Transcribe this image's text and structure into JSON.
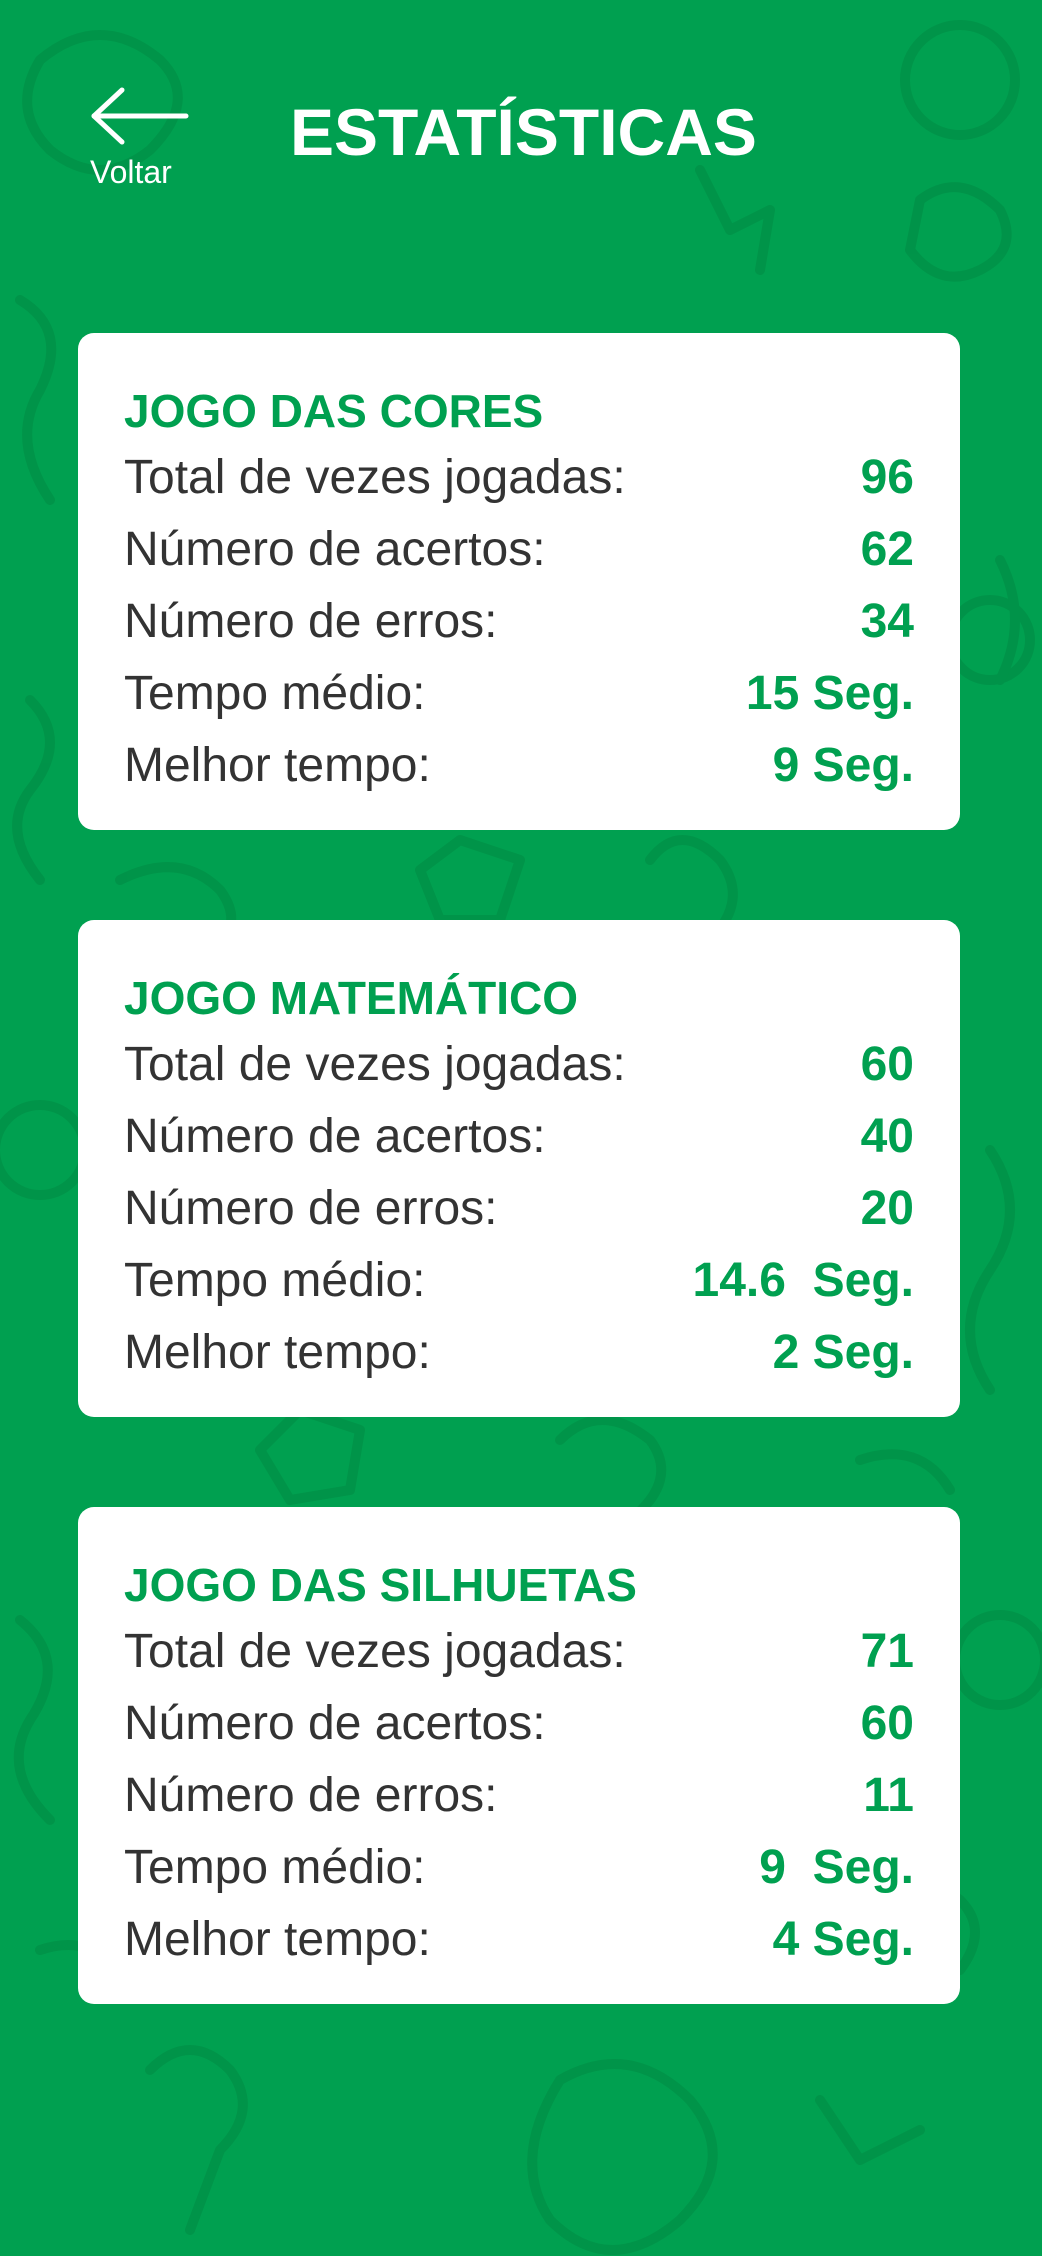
{
  "colors": {
    "background": "#00a050",
    "accent": "#00a050",
    "card": "#ffffff",
    "label_text": "#333333"
  },
  "header": {
    "back_icon": "arrow-left-icon",
    "back_label": "Voltar",
    "title": "ESTATÍSTICAS"
  },
  "cards": [
    {
      "title": "JOGO DAS CORES",
      "rows": [
        {
          "label": "Total de vezes jogadas:",
          "value": "96"
        },
        {
          "label": "Número de acertos:",
          "value": "62"
        },
        {
          "label": "Número de erros:",
          "value": "34"
        },
        {
          "label": "Tempo médio:",
          "value": "15 Seg."
        },
        {
          "label": "Melhor tempo:",
          "value": "9 Seg."
        }
      ]
    },
    {
      "title": "JOGO MATEMÁTICO",
      "rows": [
        {
          "label": "Total de vezes jogadas:",
          "value": "60"
        },
        {
          "label": "Número de acertos:",
          "value": "40"
        },
        {
          "label": "Número de erros:",
          "value": "20"
        },
        {
          "label": "Tempo médio:",
          "value": "14.6  Seg."
        },
        {
          "label": "Melhor tempo:",
          "value": "2 Seg."
        }
      ]
    },
    {
      "title": "JOGO DAS SILHUETAS",
      "rows": [
        {
          "label": "Total de vezes jogadas:",
          "value": "71"
        },
        {
          "label": "Número de acertos:",
          "value": "60"
        },
        {
          "label": "Número de erros:",
          "value": "11"
        },
        {
          "label": "Tempo médio:",
          "value": "9  Seg."
        },
        {
          "label": "Melhor tempo:",
          "value": "4 Seg."
        }
      ]
    }
  ]
}
